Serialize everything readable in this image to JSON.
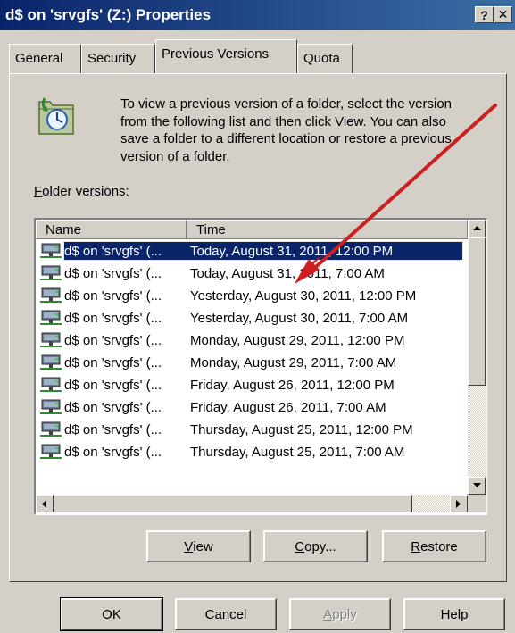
{
  "window": {
    "title": "d$ on 'srvgfs' (Z:) Properties",
    "help_label": "?",
    "close_label": "✕"
  },
  "tabs": [
    {
      "label": "General",
      "active": false
    },
    {
      "label": "Security",
      "active": false
    },
    {
      "label": "Previous Versions",
      "active": true
    },
    {
      "label": "Quota",
      "active": false
    }
  ],
  "description": "To view a previous version of a folder, select the version from the following list and then click View. You can also save a folder to a different location or restore a previous version of a folder.",
  "folder_versions": {
    "label_accel": "F",
    "label_rest": "older versions:",
    "columns": [
      "Name",
      "Time"
    ],
    "rows": [
      {
        "name": "d$ on 'srvgfs' (...",
        "time": "Today, August 31, 2011, 12:00 PM",
        "selected": true
      },
      {
        "name": "d$ on 'srvgfs' (...",
        "time": "Today, August 31, 2011, 7:00 AM",
        "selected": false
      },
      {
        "name": "d$ on 'srvgfs' (...",
        "time": "Yesterday, August 30, 2011, 12:00 PM",
        "selected": false
      },
      {
        "name": "d$ on 'srvgfs' (...",
        "time": "Yesterday, August 30, 2011, 7:00 AM",
        "selected": false
      },
      {
        "name": "d$ on 'srvgfs' (...",
        "time": "Monday, August 29, 2011, 12:00 PM",
        "selected": false
      },
      {
        "name": "d$ on 'srvgfs' (...",
        "time": "Monday, August 29, 2011, 7:00 AM",
        "selected": false
      },
      {
        "name": "d$ on 'srvgfs' (...",
        "time": "Friday, August 26, 2011, 12:00 PM",
        "selected": false
      },
      {
        "name": "d$ on 'srvgfs' (...",
        "time": "Friday, August 26, 2011, 7:00 AM",
        "selected": false
      },
      {
        "name": "d$ on 'srvgfs' (...",
        "time": "Thursday, August 25, 2011, 12:00 PM",
        "selected": false
      },
      {
        "name": "d$ on 'srvgfs' (...",
        "time": "Thursday, August 25, 2011, 7:00 AM",
        "selected": false
      }
    ]
  },
  "actions": {
    "view": {
      "accel": "V",
      "rest": "iew"
    },
    "copy": {
      "accel": "C",
      "rest": "opy..."
    },
    "restore": {
      "accel": "R",
      "rest": "estore"
    }
  },
  "footer": {
    "ok": "OK",
    "cancel": "Cancel",
    "apply_accel": "A",
    "apply_rest": "pply",
    "help": "Help"
  },
  "colors": {
    "titlebar": "#0a246a",
    "selection": "#0a246a",
    "annotation_arrow": "#cc1f1f"
  },
  "icons": {
    "folder_versions": "folder-history-icon",
    "row": "network-drive-icon"
  }
}
